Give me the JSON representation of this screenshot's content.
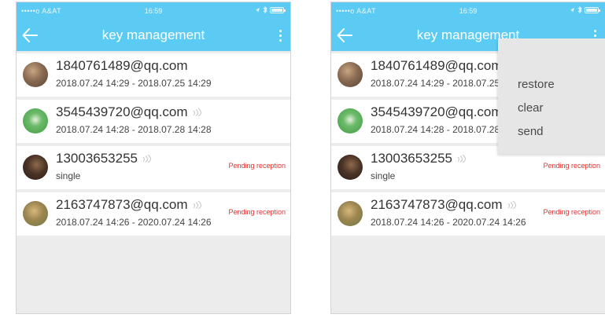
{
  "status_bar": {
    "carrier": "•••••o  A&AT",
    "time": "16:59"
  },
  "app_bar": {
    "title": "key management",
    "back_icon": "arrow-left-icon",
    "more_icon": "kebab-menu-icon"
  },
  "colors": {
    "header": "#5ccbf4",
    "pending": "#e5322d",
    "menu_bg": "#e6e6e6"
  },
  "keys": [
    {
      "account": "1840761489@qq.com",
      "detail": "2018.07.24 14:29 - 2018.07.25 14:29",
      "status": "",
      "has_signal": false
    },
    {
      "account": "3545439720@qq.com",
      "detail": "2018.07.24 14:28 - 2018.07.28 14:28",
      "status": "",
      "has_signal": true
    },
    {
      "account": "13003653255",
      "detail": "single",
      "status": "Pending reception",
      "has_signal": true
    },
    {
      "account": "2163747873@qq.com",
      "detail": "2018.07.24 14:26 - 2020.07.24 14:26",
      "status": "Pending reception",
      "has_signal": true
    }
  ],
  "menu": {
    "items": [
      "restore",
      "clear",
      "send"
    ]
  }
}
